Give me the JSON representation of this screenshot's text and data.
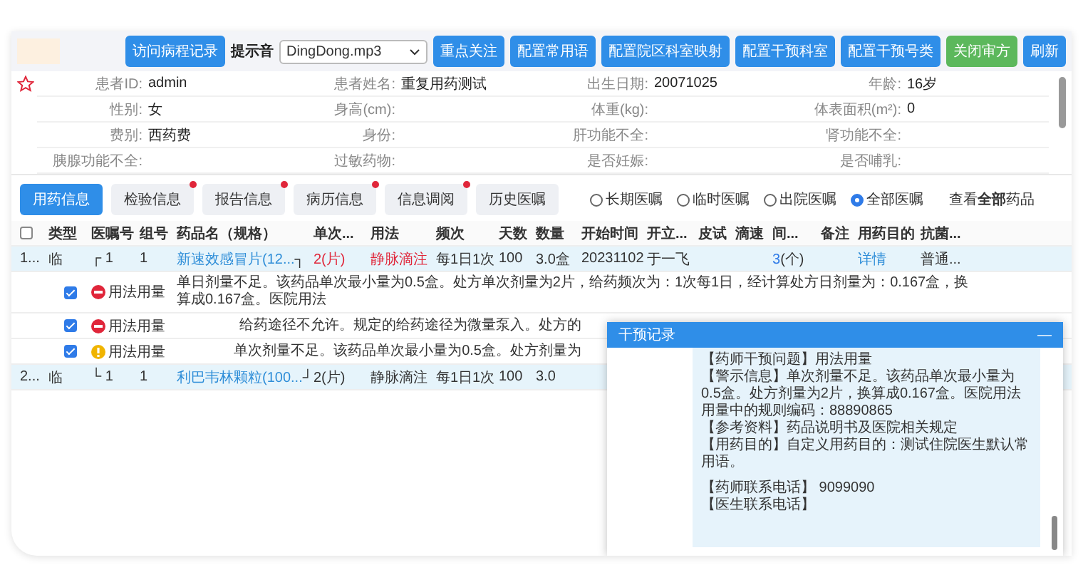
{
  "toolbar": {
    "buttons": [
      {
        "label": "访问病程记录",
        "kind": "primary"
      },
      {
        "label": "重点关注",
        "kind": "primary"
      },
      {
        "label": "配置常用语",
        "kind": "primary"
      },
      {
        "label": "配置院区科室映射",
        "kind": "primary"
      },
      {
        "label": "配置干预科室",
        "kind": "primary"
      },
      {
        "label": "配置干预号类",
        "kind": "primary"
      },
      {
        "label": "关闭审方",
        "kind": "success"
      },
      {
        "label": "刷新",
        "kind": "primary"
      }
    ],
    "sound_label": "提示音",
    "sound_value": "DingDong.mp3"
  },
  "patient": {
    "starred": false,
    "fields": [
      {
        "label": "患者ID:",
        "value": "admin"
      },
      {
        "label": "患者姓名:",
        "value": "重复用药测试"
      },
      {
        "label": "出生日期:",
        "value": "20071025"
      },
      {
        "label": "年龄:",
        "value": "16岁"
      },
      {
        "label": "性别:",
        "value": "女"
      },
      {
        "label": "身高(cm):"
      },
      {
        "label": "体重(kg):"
      },
      {
        "label": "体表面积(m²):",
        "value": "0"
      },
      {
        "label": "费别:",
        "value": "西药费"
      },
      {
        "label": "身份:"
      },
      {
        "label": "肝功能不全:"
      },
      {
        "label": "肾功能不全:"
      },
      {
        "label": "胰腺功能不全:"
      },
      {
        "label": "过敏药物:"
      },
      {
        "label": "是否妊娠:"
      },
      {
        "label": "是否哺乳:"
      }
    ]
  },
  "tabs": [
    {
      "label": "用药信息",
      "selected": true,
      "badge": false
    },
    {
      "label": "检验信息",
      "selected": false,
      "badge": true
    },
    {
      "label": "报告信息",
      "selected": false,
      "badge": true
    },
    {
      "label": "病历信息",
      "selected": false,
      "badge": true
    },
    {
      "label": "信息调阅",
      "selected": false,
      "badge": true
    },
    {
      "label": "历史医嘱",
      "selected": false,
      "badge": false
    }
  ],
  "filters": [
    {
      "label": "长期医嘱",
      "selected": false
    },
    {
      "label": "临时医嘱",
      "selected": false
    },
    {
      "label": "出院医嘱",
      "selected": false
    },
    {
      "label": "全部医嘱",
      "selected": true
    }
  ],
  "view_all": "查看**全部**药品",
  "table": {
    "select_all": false,
    "columns": [
      "类型",
      "医嘱号",
      "组号",
      "药品名（规格）",
      "单次...",
      "用法",
      "频次",
      "天数",
      "数量",
      "开始时间",
      "开立...",
      "皮试",
      "滴速",
      "间...",
      "备注",
      "用药目的",
      "抗菌..."
    ],
    "rows": [
      {
        "kind": "order",
        "no": "1...",
        "type": "临",
        "group_mark": "┌",
        "order_no": "1",
        "group_no": "1",
        "drug": "新速效感冒片(12...",
        "drug_mark": "┐",
        "dose": "2(片)",
        "route": "静脉滴注",
        "freq": "每1日1次",
        "days": "100",
        "qty": "3.0盒",
        "start": "20231102",
        "doctor": "于一飞",
        "issues": "3",
        "issues_unit": "(个)",
        "purpose": "详情",
        "antibiotic": "普通...",
        "flagged": true
      },
      {
        "kind": "warning",
        "checked": true,
        "critical": true,
        "issue": "用法用量",
        "message": "单日剂量不足。该药品单次最小量为0.5盒。处方单次剂量为2片，给药频次为：1次每1日，经计算处方日剂量为：0.167盒，换算成0.167盒。医院用法"
      },
      {
        "kind": "warning",
        "checked": true,
        "critical": true,
        "issue": "用法用量",
        "message": "给药途径不允许。规定的给药途径为微量泵入。处方的"
      },
      {
        "kind": "warning",
        "checked": true,
        "critical": false,
        "issue": "用法用量",
        "message": "单次剂量不足。该药品单次最小量为0.5盒。处方剂量为"
      },
      {
        "kind": "order",
        "no": "2...",
        "type": "临",
        "group_mark": "└",
        "order_no": "1",
        "group_no": "1",
        "drug": "利巴韦林颗粒(100...",
        "drug_mark": "┘",
        "dose": "2(片)",
        "route": "静脉滴注",
        "freq": "每1日1次",
        "days": "100",
        "qty": "3.0",
        "flagged": false
      }
    ]
  },
  "dialog": {
    "title": "干预记录",
    "minimize": "—",
    "lines": [
      "【药师干预问题】用法用量",
      "【警示信息】单次剂量不足。该药品单次最小量为0.5盒。处方剂量为2片，换算成0.167盒。医院用法用量中的规则编码：88890865",
      "【参考资料】药品说明书及医院相关规定",
      "【用药目的】自定义用药目的：测试住院医生默认常用语。",
      "【药师联系电话】 9099090",
      "【医生联系电话】"
    ]
  }
}
